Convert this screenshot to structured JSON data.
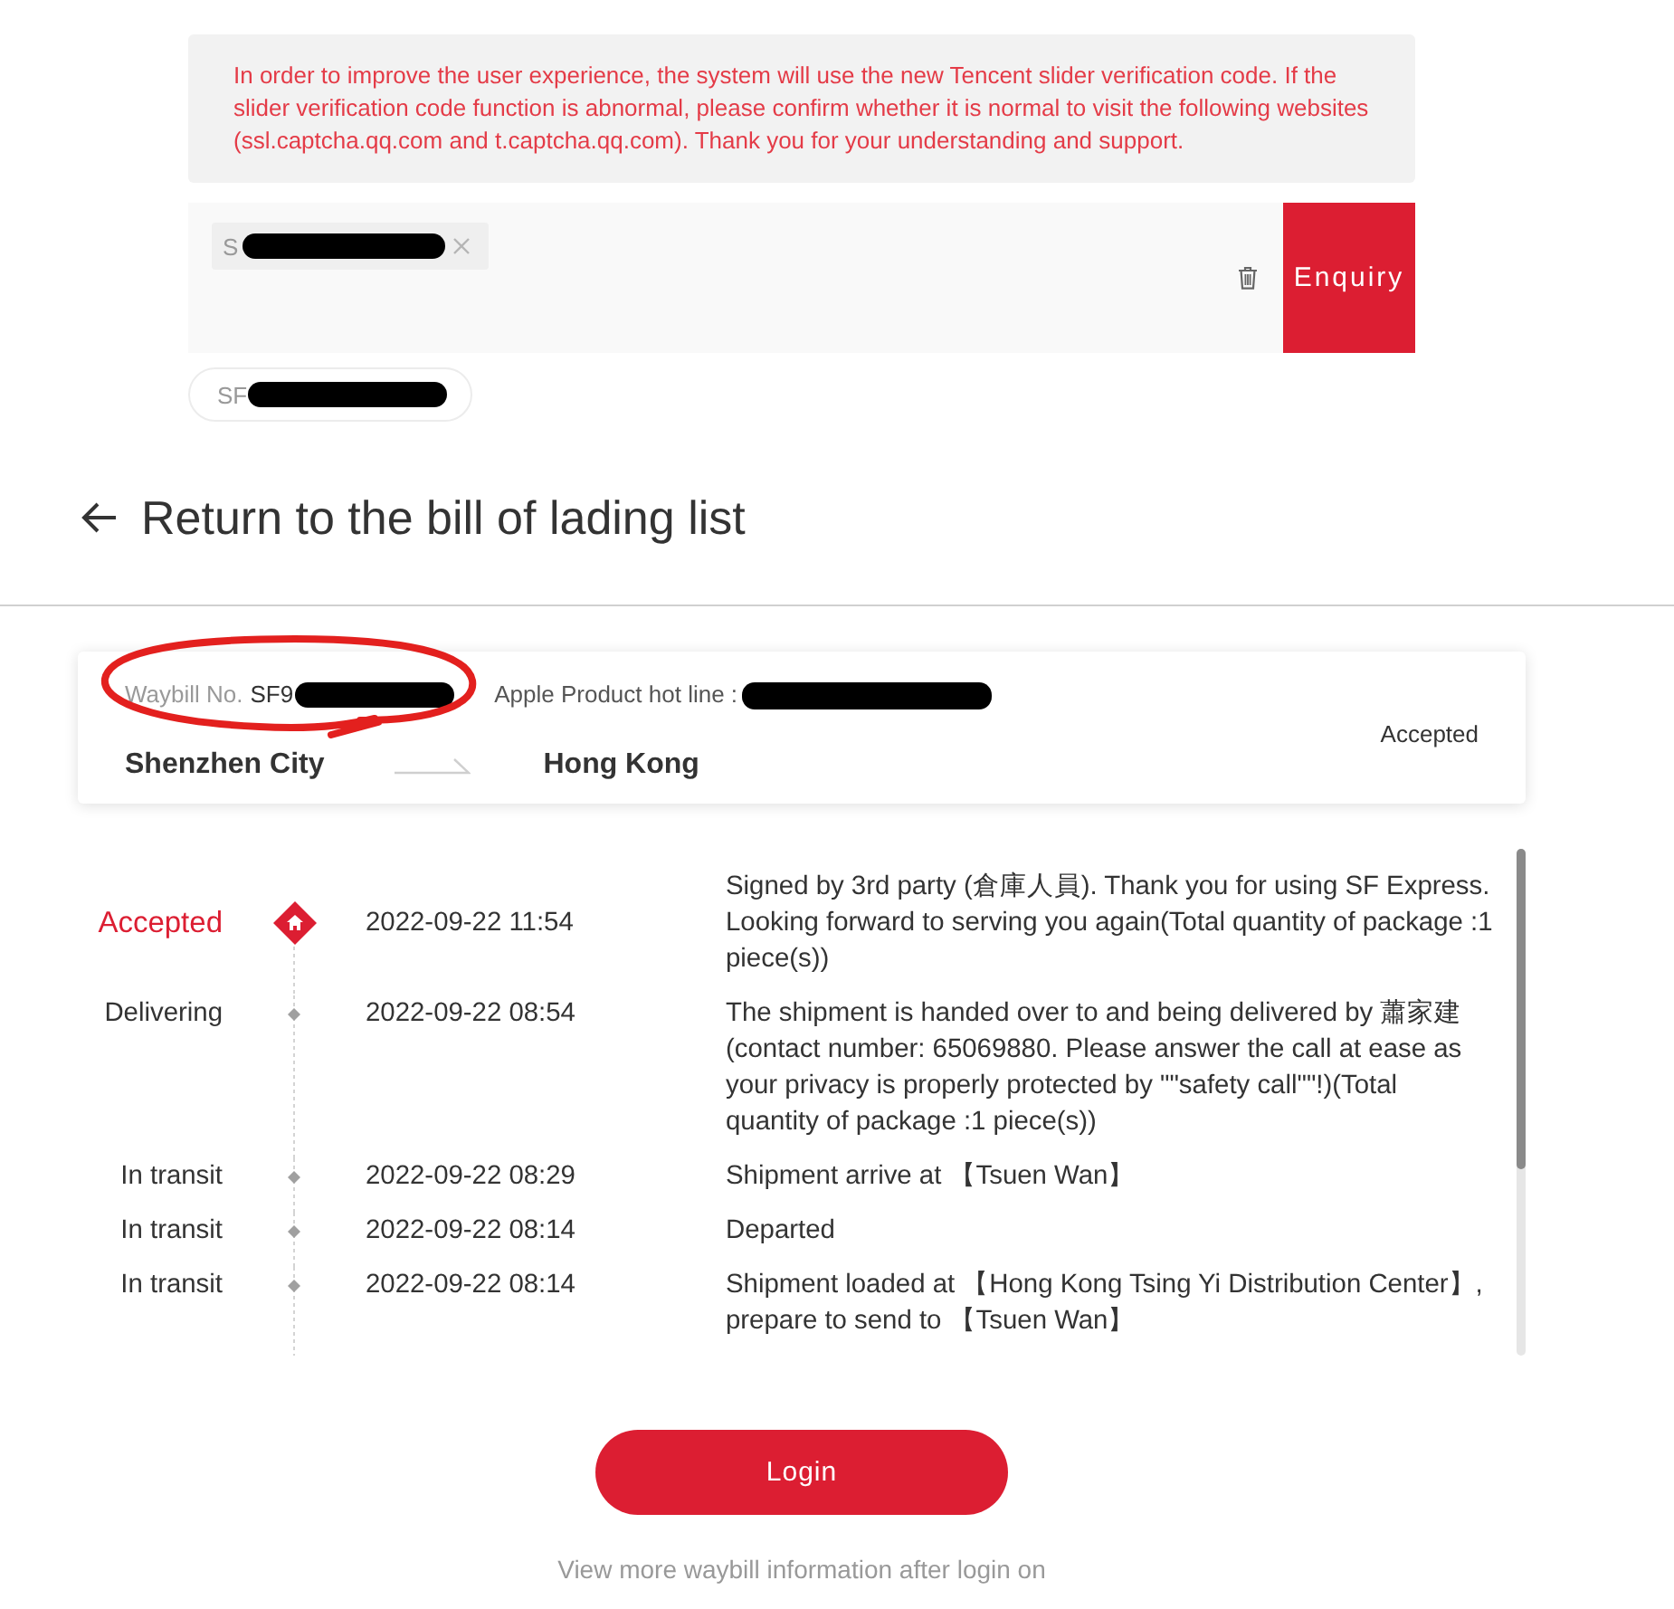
{
  "notice": {
    "text": "In order to improve the user experience, the system will use the new Tencent slider verification code. If the slider verification code function is abnormal, please confirm whether it is normal to visit the following websites (ssl.captcha.qq.com and t.captcha.qq.com). Thank you for your understanding and support."
  },
  "search": {
    "chips": [
      {
        "text": "S",
        "redacted": true
      }
    ],
    "button": "Enquiry"
  },
  "history": [
    {
      "text": "SF",
      "redacted": true
    }
  ],
  "back_link": {
    "label": "Return to the bill of lading list"
  },
  "waybill_card": {
    "waybill_label": "Waybill No.",
    "waybill_number": "SF9",
    "waybill_redacted": true,
    "hotline_label": "Apple Product hot line :",
    "hotline_redacted": true,
    "origin": "Shenzhen City",
    "destination": "Hong Kong",
    "status": "Accepted",
    "annotated": true
  },
  "timeline": [
    {
      "kind": "latest",
      "status": "Accepted",
      "time": "2022-09-22 11:54",
      "description": "Signed by 3rd party (倉庫人員). Thank you for using SF Express. Looking forward to serving you again(Total quantity of package :1 piece(s))"
    },
    {
      "kind": "event",
      "status": "Delivering",
      "time": "2022-09-22 08:54",
      "description": "The shipment is handed over to and being delivered by 蕭家建(contact number: 65069880. Please answer the call at ease as your privacy is properly protected by \"\"safety call\"\"!)(Total quantity of package :1 piece(s))"
    },
    {
      "kind": "event",
      "status": "In transit",
      "time": "2022-09-22 08:29",
      "description": "Shipment arrive at 【Tsuen Wan】"
    },
    {
      "kind": "event",
      "status": "In transit",
      "time": "2022-09-22 08:14",
      "description": "Departed"
    },
    {
      "kind": "event",
      "status": "In transit",
      "time": "2022-09-22 08:14",
      "description": "Shipment loaded at 【Hong Kong Tsing Yi Distribution Center】, prepare to send to 【Tsuen Wan】"
    }
  ],
  "login_button": {
    "label": "Login"
  },
  "login_hint": "View more waybill information after login on"
}
